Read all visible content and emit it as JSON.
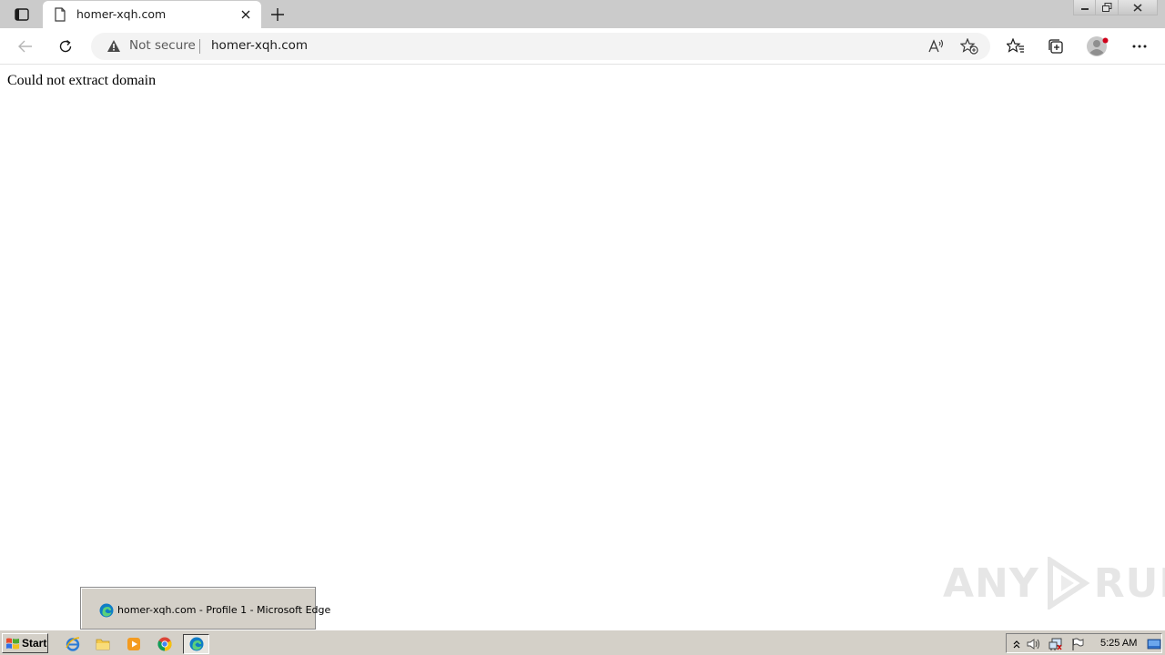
{
  "browser": {
    "tab": {
      "title": "homer-xqh.com"
    },
    "address_bar": {
      "security_label": "Not secure",
      "url": "homer-xqh.com"
    }
  },
  "page": {
    "message": "Could not extract domain"
  },
  "watermark": {
    "left_text": "ANY",
    "right_text": "RUN"
  },
  "taskbar": {
    "start_label": "Start",
    "preview_title": "homer-xqh.com - Profile 1 - Microsoft Edge",
    "clock": "5:25 AM"
  },
  "colors": {
    "tabstrip_bg": "#cbcbcb",
    "taskbar_bg": "#d4d0c8",
    "profile_dot": "#d0021b"
  },
  "icons": [
    "tab-actions-icon",
    "page-favicon-icon",
    "close-icon",
    "plus-icon",
    "minimize-icon",
    "restore-icon",
    "window-close-icon",
    "back-arrow-icon",
    "refresh-icon",
    "warning-icon",
    "read-aloud-icon",
    "add-favorite-icon",
    "favorites-icon",
    "collections-icon",
    "profile-icon",
    "more-icon",
    "edge-icon",
    "windows-logo-icon",
    "ie-icon",
    "folder-icon",
    "media-player-icon",
    "chrome-icon",
    "chevron-up-icon",
    "volume-icon",
    "network-icon",
    "flag-icon",
    "show-desktop-icon"
  ]
}
